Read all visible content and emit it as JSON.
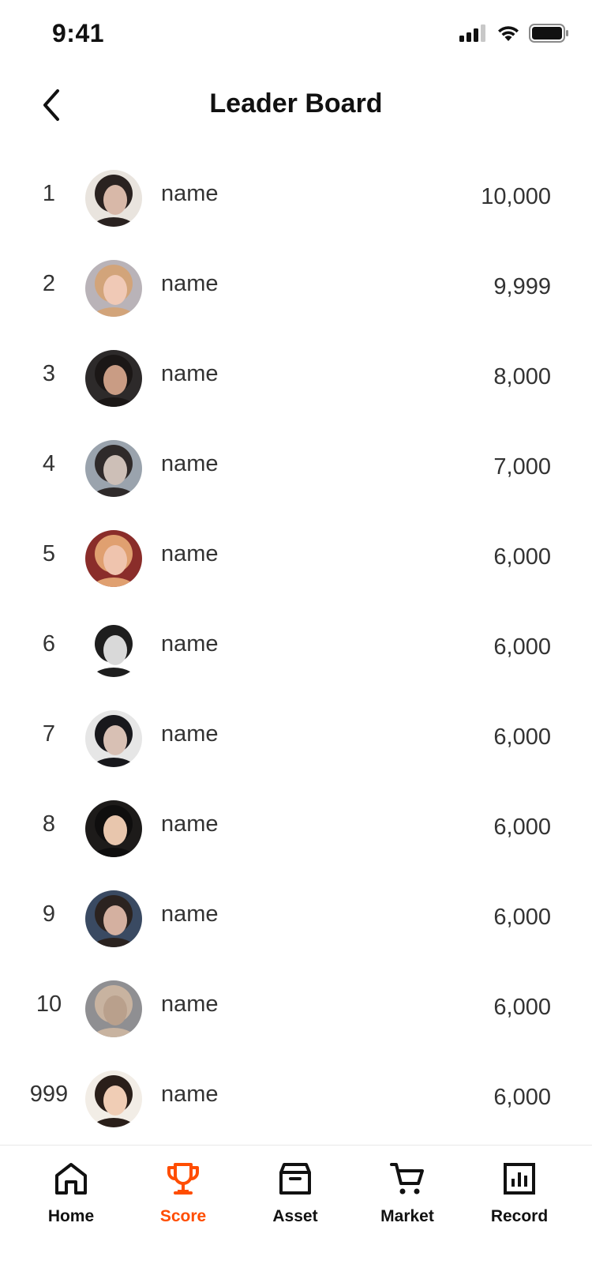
{
  "status_bar": {
    "time": "9:41",
    "icons": [
      "signal-icon",
      "wifi-icon",
      "battery-icon"
    ]
  },
  "header": {
    "title": "Leader Board",
    "back_icon": "chevron-left-icon"
  },
  "leaderboard": [
    {
      "rank": "1",
      "name": "name",
      "score": "10,000",
      "avatar_colors": [
        "#e9e4de",
        "#2a2220",
        "#d8b8a8"
      ]
    },
    {
      "rank": "2",
      "name": "name",
      "score": "9,999",
      "avatar_colors": [
        "#b9b3b8",
        "#d2a47a",
        "#f0c9b6"
      ]
    },
    {
      "rank": "3",
      "name": "name",
      "score": "8,000",
      "avatar_colors": [
        "#2d2a2a",
        "#1b1716",
        "#c99c84"
      ]
    },
    {
      "rank": "4",
      "name": "name",
      "score": "7,000",
      "avatar_colors": [
        "#9aa3ad",
        "#2f2a2a",
        "#cdbfb7"
      ]
    },
    {
      "rank": "5",
      "name": "name",
      "score": "6,000",
      "avatar_colors": [
        "#8a2d2a",
        "#e0a070",
        "#efc4ae"
      ]
    },
    {
      "rank": "6",
      "name": "name",
      "score": "6,000",
      "avatar_colors": [
        "#ffffff",
        "#1e1e1e",
        "#d9d9d9"
      ]
    },
    {
      "rank": "7",
      "name": "name",
      "score": "6,000",
      "avatar_colors": [
        "#e6e6e6",
        "#18181c",
        "#d8c0b4"
      ]
    },
    {
      "rank": "8",
      "name": "name",
      "score": "6,000",
      "avatar_colors": [
        "#1d1b1a",
        "#0f0e0e",
        "#e8c6ad"
      ]
    },
    {
      "rank": "9",
      "name": "name",
      "score": "6,000",
      "avatar_colors": [
        "#3a4a62",
        "#2b2320",
        "#d4b0a0"
      ]
    },
    {
      "rank": "10",
      "name": "name",
      "score": "6,000",
      "avatar_colors": [
        "#8f8f92",
        "#c8b3a0",
        "#b9a08c"
      ]
    },
    {
      "rank": "999",
      "name": "name",
      "score": "6,000",
      "avatar_colors": [
        "#f2ede6",
        "#2a1f1a",
        "#f0cdb5"
      ]
    }
  ],
  "tab_bar": {
    "tabs": [
      {
        "label": "Home",
        "icon": "home-icon",
        "active": false
      },
      {
        "label": "Score",
        "icon": "trophy-icon",
        "active": true
      },
      {
        "label": "Asset",
        "icon": "box-icon",
        "active": false
      },
      {
        "label": "Market",
        "icon": "cart-icon",
        "active": false
      },
      {
        "label": "Record",
        "icon": "bar-chart-icon",
        "active": false
      }
    ],
    "active_color": "#ff4d00",
    "inactive_color": "#111111"
  }
}
